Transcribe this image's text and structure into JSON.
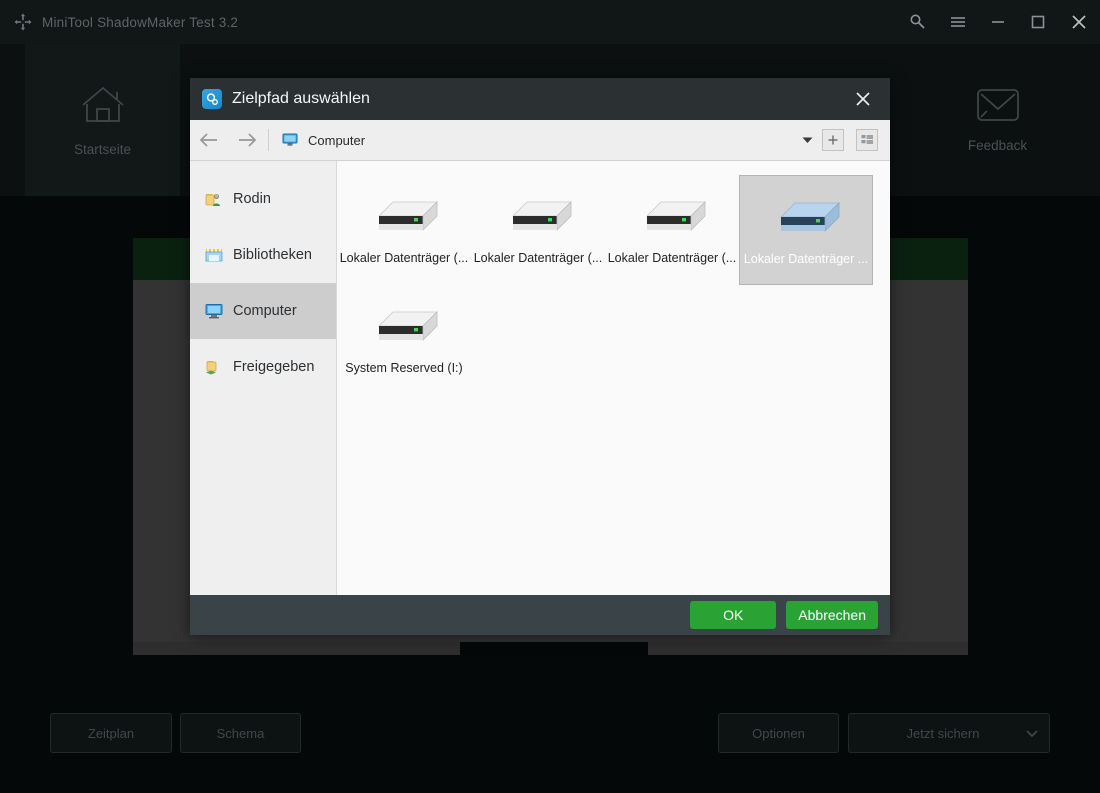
{
  "window": {
    "title": "MiniTool ShadowMaker Test 3.2",
    "logo_icon": "shadowmaker-logo-icon",
    "controls": [
      {
        "name": "search-icon",
        "glyph": "key"
      },
      {
        "name": "menu-icon",
        "glyph": "hamburger"
      },
      {
        "name": "minimize-icon",
        "glyph": "minimize"
      },
      {
        "name": "maximize-icon",
        "glyph": "maximize"
      },
      {
        "name": "close-icon",
        "glyph": "close"
      }
    ]
  },
  "topnav": {
    "items": [
      {
        "label": "Startseite",
        "icon": "home-icon"
      },
      {
        "label": "Feedback",
        "icon": "envelope-icon"
      }
    ]
  },
  "toolbar": {
    "zeitplan_label": "Zeitplan",
    "schema_label": "Schema",
    "optionen_label": "Optionen",
    "sichern_label": "Jetzt sichern",
    "sichern_caret_icon": "chevron-down-icon"
  },
  "dialog": {
    "title": "Zielpfad auswählen",
    "title_icon": "folder-search-icon",
    "close_icon": "close-icon",
    "addressbar": {
      "back_icon": "arrow-left-icon",
      "forward_icon": "arrow-right-icon",
      "location_icon": "computer-icon",
      "location": "Computer",
      "caret_icon": "chevron-down-icon",
      "new_folder_icon": "plus-icon",
      "view_mode_icon": "list-view-icon"
    },
    "sidebar": {
      "items": [
        {
          "label": "Rodin",
          "icon": "user-folder-icon",
          "active": false
        },
        {
          "label": "Bibliotheken",
          "icon": "libraries-icon",
          "active": false
        },
        {
          "label": "Computer",
          "icon": "computer-icon",
          "active": true
        },
        {
          "label": "Freigegeben",
          "icon": "shared-folder-icon",
          "active": false
        }
      ]
    },
    "files": [
      {
        "label": "Lokaler Datenträger (...",
        "icon": "drive-icon",
        "selected": false
      },
      {
        "label": "Lokaler Datenträger (...",
        "icon": "drive-icon",
        "selected": false
      },
      {
        "label": "Lokaler Datenträger (...",
        "icon": "drive-icon",
        "selected": false
      },
      {
        "label": "Lokaler Datenträger ...",
        "icon": "drive-icon",
        "selected": true
      },
      {
        "label": "System Reserved (I:)",
        "icon": "drive-icon",
        "selected": false
      }
    ],
    "buttons": {
      "ok_label": "OK",
      "cancel_label": "Abbrechen"
    }
  },
  "colors": {
    "accent_green": "#2aa334",
    "dialog_header": "#2b3033",
    "dialog_footer": "#3a4347",
    "app_background": "#050809",
    "panel": "#333333",
    "green_bar": "#0b2110"
  }
}
